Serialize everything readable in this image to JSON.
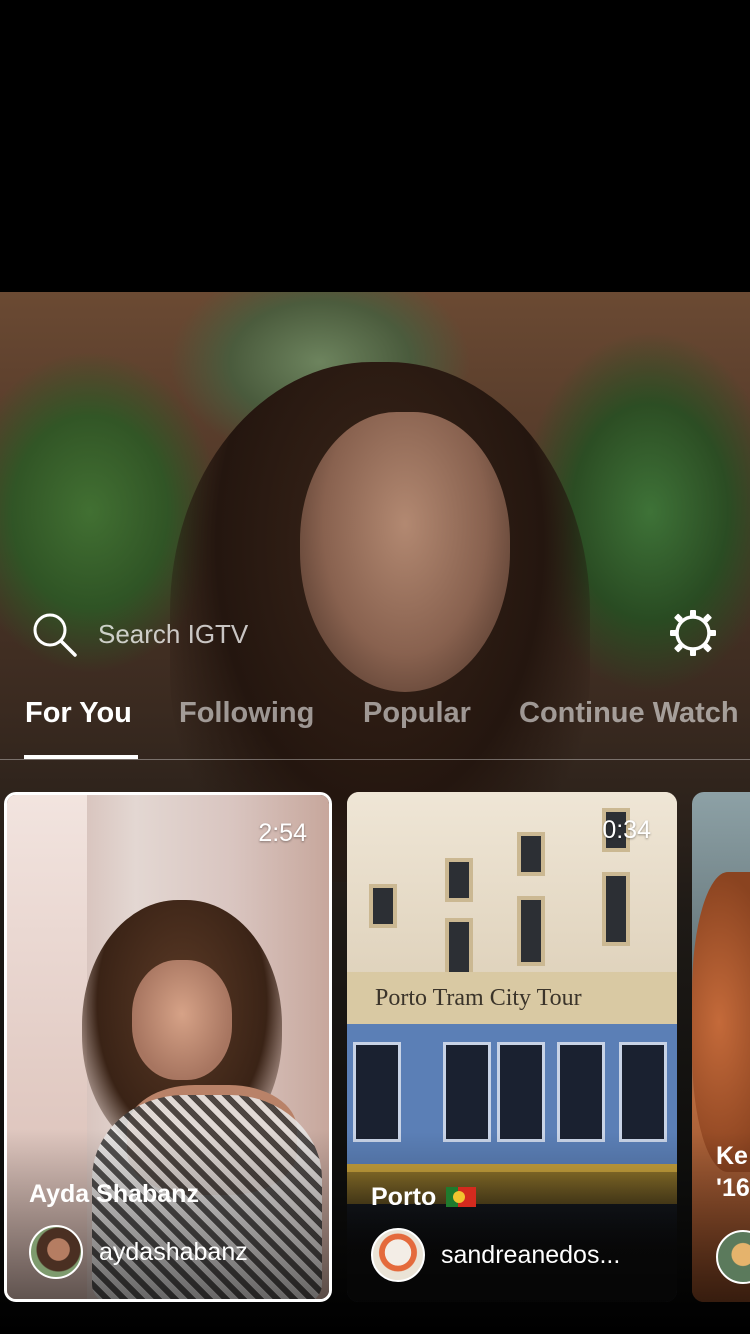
{
  "search": {
    "placeholder": "Search IGTV"
  },
  "tabs": [
    {
      "label": "For You",
      "active": true
    },
    {
      "label": "Following",
      "active": false
    },
    {
      "label": "Popular",
      "active": false
    },
    {
      "label": "Continue Watch",
      "active": false
    }
  ],
  "cards": [
    {
      "duration": "2:54",
      "title": "Ayda Shabanz",
      "handle": "aydashabanz",
      "selected": true
    },
    {
      "duration": "0:34",
      "title": "Porto",
      "handle": "sandreanedos...",
      "flag": "portugal-flag",
      "thumbnail_text": "Porto Tram City Tour"
    },
    {
      "title": "Ke '16",
      "handle": ""
    }
  ],
  "colors": {
    "background": "#000000",
    "active_tab": "#ffffff",
    "inactive_tab": "#8f8f8f"
  },
  "icons": {
    "search": "search-icon",
    "settings": "settings-icon"
  }
}
